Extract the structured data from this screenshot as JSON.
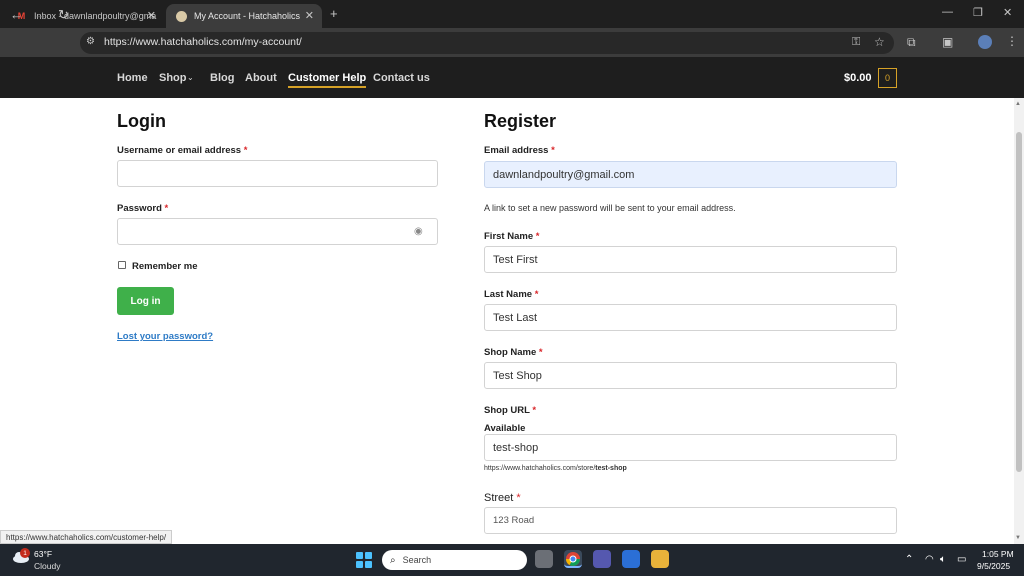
{
  "browser": {
    "tabs": [
      {
        "title": "Inbox - dawnlandpoultry@gma",
        "icon": "gmail-icon"
      },
      {
        "title": "My Account - Hatchaholics",
        "icon": "site-favicon"
      }
    ],
    "url": "https://www.hatchaholics.com/my-account/",
    "status_url": "https://www.hatchaholics.com/customer-help/"
  },
  "site_nav": {
    "links": [
      "Home",
      "Shop",
      "Blog",
      "About",
      "Customer Help",
      "Contact us"
    ],
    "cart_total": "$0.00",
    "cart_count": "0",
    "accent_color": "#d6a227"
  },
  "login": {
    "heading": "Login",
    "username_label": "Username or email address",
    "password_label": "Password",
    "remember_label": "Remember me",
    "button_label": "Log in",
    "button_color": "#3fb04a",
    "lost_password": "Lost your password?"
  },
  "register": {
    "heading": "Register",
    "email_label": "Email address",
    "email_value": "dawnlandpoultry@gmail.com",
    "password_hint": "A link to set a new password will be sent to your email address.",
    "first_name_label": "First Name",
    "first_name_value": "Test First",
    "last_name_label": "Last Name",
    "last_name_value": "Test Last",
    "shop_name_label": "Shop Name",
    "shop_name_value": "Test Shop",
    "shop_url_label": "Shop URL",
    "shop_url_status": "Available",
    "shop_url_value": "test-shop",
    "shop_url_preview_base": "https://www.hatchaholics.com/store/",
    "shop_url_preview_slug": "test-shop",
    "street_label": "Street",
    "street_placeholder": "123 Road"
  },
  "required_mark": "*",
  "taskbar": {
    "weather_temp": "63°F",
    "weather_condition": "Cloudy",
    "weather_badge": "1",
    "search_placeholder": "Search",
    "time": "1:05 PM",
    "date": "9/5/2025"
  }
}
